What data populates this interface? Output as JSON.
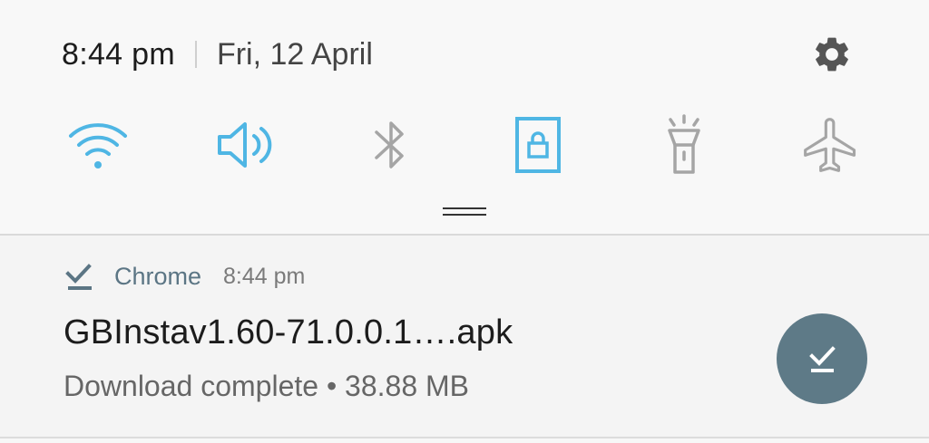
{
  "status": {
    "time": "8:44 pm",
    "date": "Fri, 12 April"
  },
  "icons": {
    "settings": "gear-icon",
    "wifi": "wifi-icon",
    "sound": "speaker-icon",
    "bluetooth": "bluetooth-icon",
    "rotation_lock": "screen-lock-icon",
    "flashlight": "flashlight-icon",
    "airplane": "airplane-icon",
    "download": "download-done-icon"
  },
  "colors": {
    "active": "#4fb6e4",
    "inactive": "#a5a5a5",
    "accent": "#5e7a87"
  },
  "notification": {
    "app_name": "Chrome",
    "time": "8:44 pm",
    "title": "GBInstav1.60-71.0.0.1….apk",
    "text": "Download complete • 38.88 MB"
  }
}
